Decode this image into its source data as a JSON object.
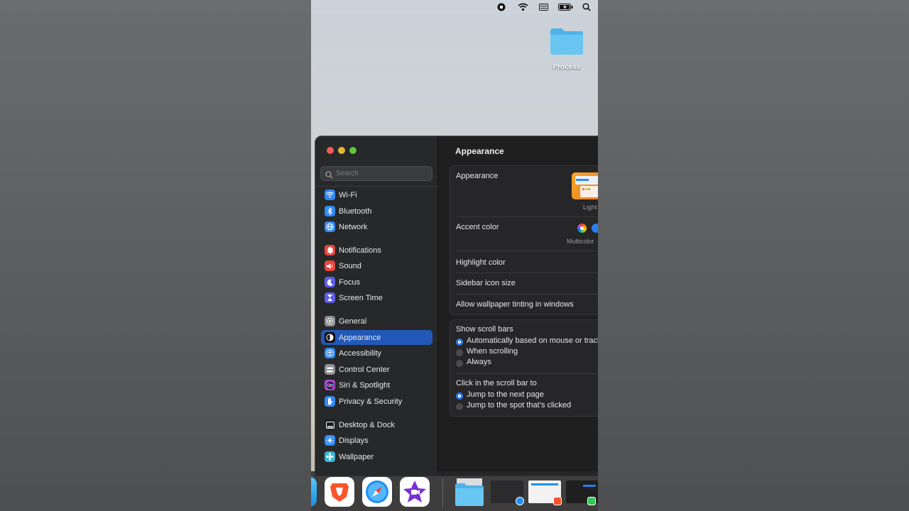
{
  "desktop": {
    "folder_label": "Process"
  },
  "search": {
    "placeholder": "Search"
  },
  "sidebar": {
    "items": [
      {
        "label": "Wi-Fi",
        "icon": "wifi-icon",
        "color": "#2f8af5"
      },
      {
        "label": "Bluetooth",
        "icon": "bluetooth-icon",
        "color": "#2f8af5"
      },
      {
        "label": "Network",
        "icon": "globe-icon",
        "color": "#2f8af5"
      },
      {
        "label": "Notifications",
        "icon": "bell-icon",
        "color": "#e8443a"
      },
      {
        "label": "Sound",
        "icon": "speaker-icon",
        "color": "#e8443a"
      },
      {
        "label": "Focus",
        "icon": "moon-icon",
        "color": "#5e5ce6"
      },
      {
        "label": "Screen Time",
        "icon": "hourglass-icon",
        "color": "#5e5ce6"
      },
      {
        "label": "General",
        "icon": "gear-icon",
        "color": "#8e8e93"
      },
      {
        "label": "Appearance",
        "icon": "appearance-icon",
        "color": "#1c1c1e"
      },
      {
        "label": "Accessibility",
        "icon": "accessibility-icon",
        "color": "#2f8af5"
      },
      {
        "label": "Control Center",
        "icon": "control-center-icon",
        "color": "#8e8e93"
      },
      {
        "label": "Siri & Spotlight",
        "icon": "siri-icon",
        "color": "#b34cd6"
      },
      {
        "label": "Privacy & Security",
        "icon": "hand-icon",
        "color": "#2f8af5"
      },
      {
        "label": "Desktop & Dock",
        "icon": "dock-icon",
        "color": "#1c1c1e"
      },
      {
        "label": "Displays",
        "icon": "sun-icon",
        "color": "#2f8af5"
      },
      {
        "label": "Wallpaper",
        "icon": "wallpaper-icon",
        "color": "#35b6d6"
      }
    ],
    "selected": "Appearance"
  },
  "main": {
    "title": "Appearance",
    "appearance_label": "Appearance",
    "appearance_option": "Light",
    "accent_label": "Accent color",
    "accent_option": "Multicolor",
    "highlight_label": "Highlight color",
    "sidebar_icon_label": "Sidebar icon size",
    "tinting_label": "Allow wallpaper tinting in windows",
    "scroll_bars_label": "Show scroll bars",
    "scroll_options": [
      {
        "label": "Automatically based on mouse or trackpad",
        "selected": true
      },
      {
        "label": "When scrolling",
        "selected": false
      },
      {
        "label": "Always",
        "selected": false
      }
    ],
    "click_label": "Click in the scroll bar to",
    "click_options": [
      {
        "label": "Jump to the next page",
        "selected": true
      },
      {
        "label": "Jump to the spot that’s clicked",
        "selected": false
      }
    ]
  }
}
